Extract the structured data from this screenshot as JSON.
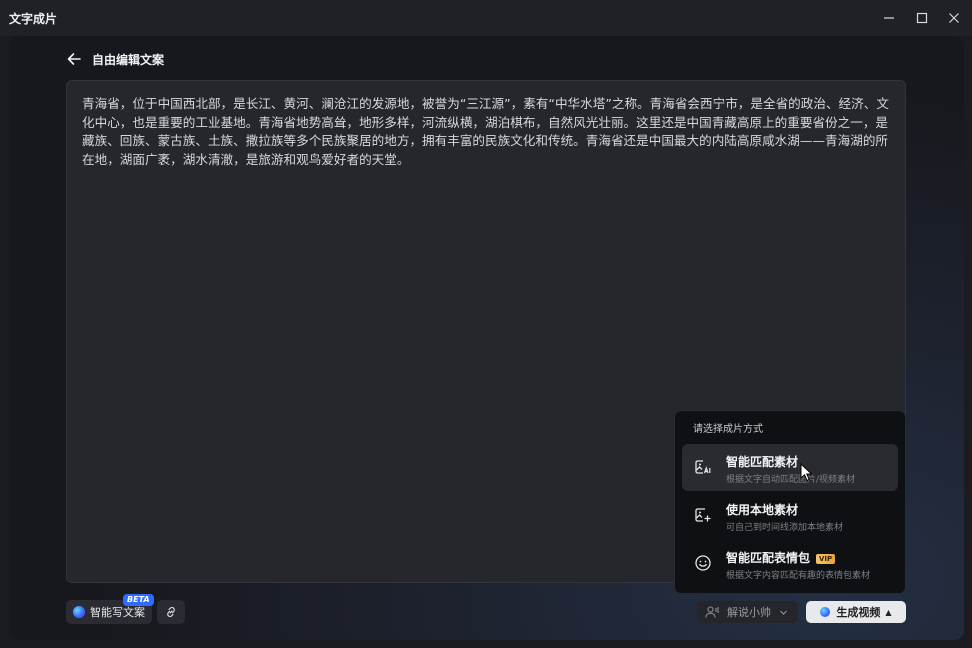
{
  "window": {
    "title": "文字成片"
  },
  "header": {
    "title": "自由编辑文案"
  },
  "editor": {
    "text": "青海省，位于中国西北部，是长江、黄河、澜沧江的发源地，被誉为“三江源”，素有“中华水塔”之称。青海省会西宁市，是全省的政治、经济、文化中心，也是重要的工业基地。青海省地势高耸，地形多样，河流纵横，湖泊棋布，自然风光壮丽。这里还是中国青藏高原上的重要省份之一，是藏族、回族、蒙古族、土族、撒拉族等多个民族聚居的地方，拥有丰富的民族文化和传统。青海省还是中国最大的内陆高原咸水湖——青海湖的所在地，湖面广袤，湖水清澈，是旅游和观鸟爱好者的天堂。"
  },
  "footer": {
    "ai_write_label": "智能写文案",
    "beta_badge": "BETA",
    "narrator_label": "解说小帅",
    "generate_label": "生成视频"
  },
  "popup": {
    "header": "请选择成片方式",
    "options": [
      {
        "title": "智能匹配素材",
        "desc": "根据文字自动匹配图片/视频素材",
        "icon": "ai-image-icon"
      },
      {
        "title": "使用本地素材",
        "desc": "可自己到时间线添加本地素材",
        "icon": "add-image-icon"
      },
      {
        "title": "智能匹配表情包",
        "desc": "根据文字内容匹配有趣的表情包素材",
        "icon": "smiley-icon",
        "badge": "VIP"
      }
    ]
  }
}
